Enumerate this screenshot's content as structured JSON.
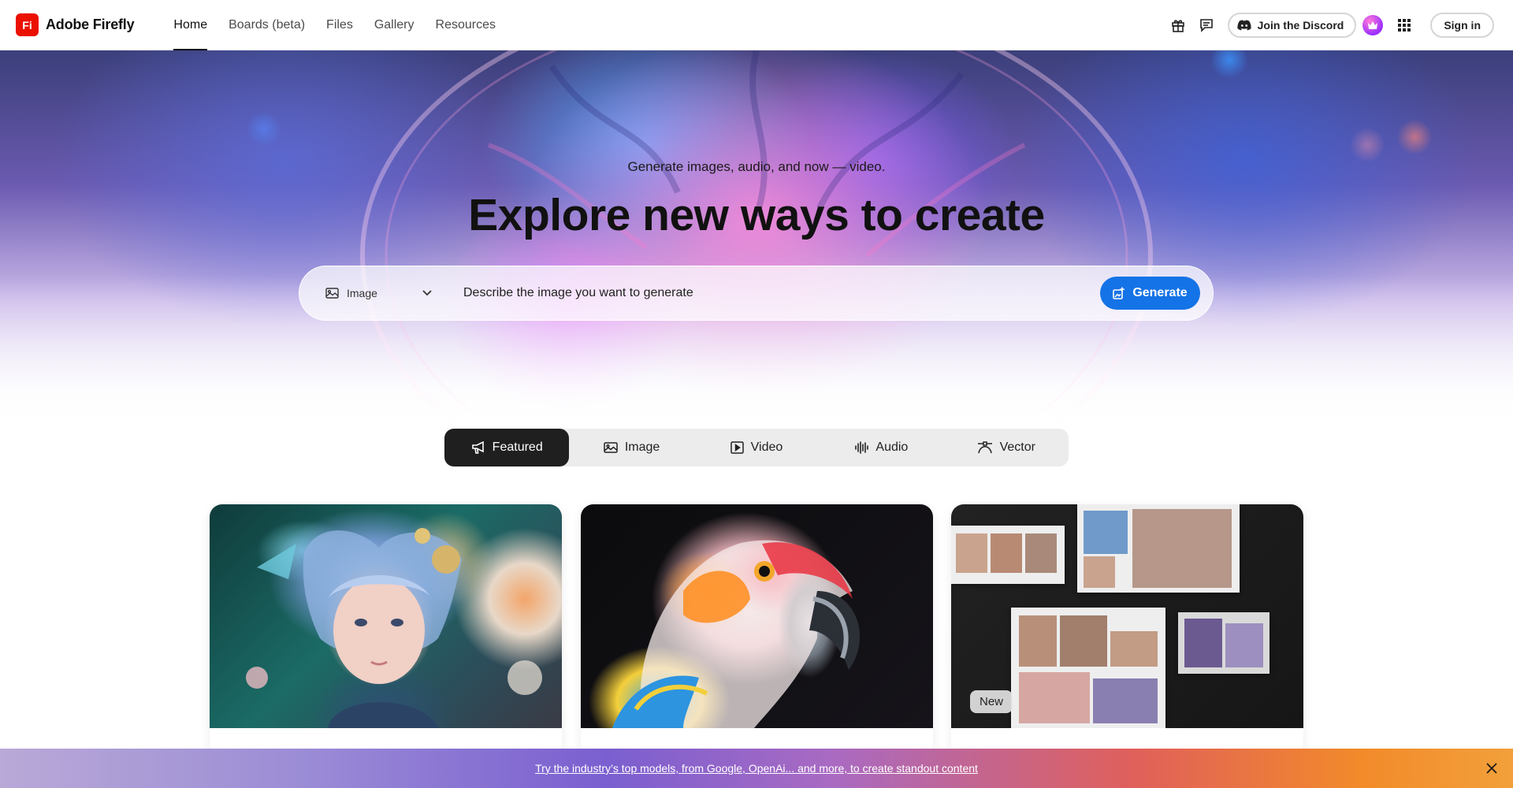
{
  "brand": {
    "logo_text": "Fi",
    "name": "Adobe Firefly",
    "logo_color": "#eb1000"
  },
  "nav": {
    "items": [
      {
        "label": "Home",
        "active": true
      },
      {
        "label": "Boards (beta)"
      },
      {
        "label": "Files"
      },
      {
        "label": "Gallery"
      },
      {
        "label": "Resources"
      }
    ]
  },
  "header_actions": {
    "gift_icon": "gift-icon",
    "feedback_icon": "chat-icon",
    "discord_label": "Join the Discord",
    "apps_icon": "grid-icon",
    "signin_label": "Sign in"
  },
  "hero": {
    "subtitle": "Generate images, audio, and now — video.",
    "title": "Explore new ways to create",
    "type_select_value": "Image",
    "prompt_placeholder": "Describe the image you want to generate",
    "generate_label": "Generate",
    "accent_color": "#1473e6"
  },
  "tabs": [
    {
      "label": "Featured",
      "icon": "megaphone-icon",
      "active": true
    },
    {
      "label": "Image",
      "icon": "image-icon"
    },
    {
      "label": "Video",
      "icon": "video-icon"
    },
    {
      "label": "Audio",
      "icon": "waveform-icon"
    },
    {
      "label": "Vector",
      "icon": "pen-curve-icon"
    }
  ],
  "cards": [
    {
      "image": "fantasy-boy-portrait"
    },
    {
      "image": "parrot-portrait"
    },
    {
      "image": "moodboards-collage",
      "badge": "New"
    }
  ],
  "banner": {
    "text": "Try the industry’s top models, from Google, OpenAi... and more, to create standout content",
    "close_icon": "close-icon"
  }
}
